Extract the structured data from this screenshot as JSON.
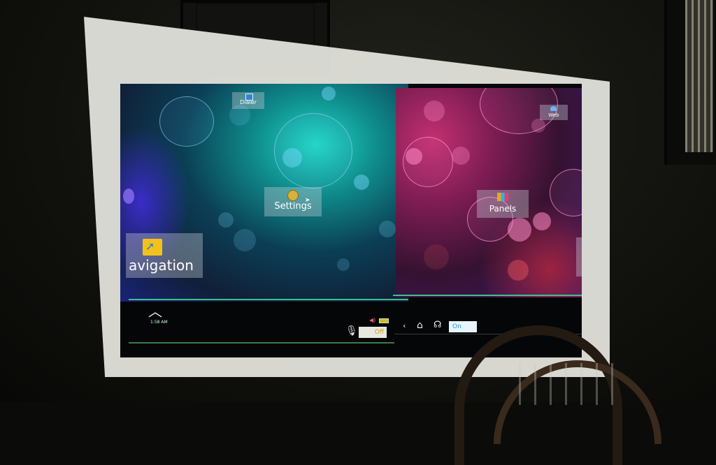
{
  "left_screen": {
    "icons": {
      "dialer": "Dialer",
      "settings": "Settings",
      "navigation": "avigation"
    },
    "status": {
      "time": "1:58 AM",
      "toggle_label": "Off"
    }
  },
  "right_screen": {
    "icons": {
      "web": "Web",
      "panels": "Panels"
    },
    "status": {
      "toggle_label": "On"
    }
  },
  "icon_names": [
    "phone-icon",
    "gear-icon",
    "navigation-arrow-icon",
    "cloud-icon",
    "bar-chart-icon",
    "chevron-up-icon",
    "microphone-icon",
    "volume-icon",
    "battery-icon",
    "back-icon",
    "home-icon",
    "voice-icon",
    "cursor-icon"
  ],
  "colors": {
    "left_wallpaper": "#0f8d8c",
    "right_wallpaper": "#7a1c52",
    "bar_accent": "#3fbf8c"
  }
}
